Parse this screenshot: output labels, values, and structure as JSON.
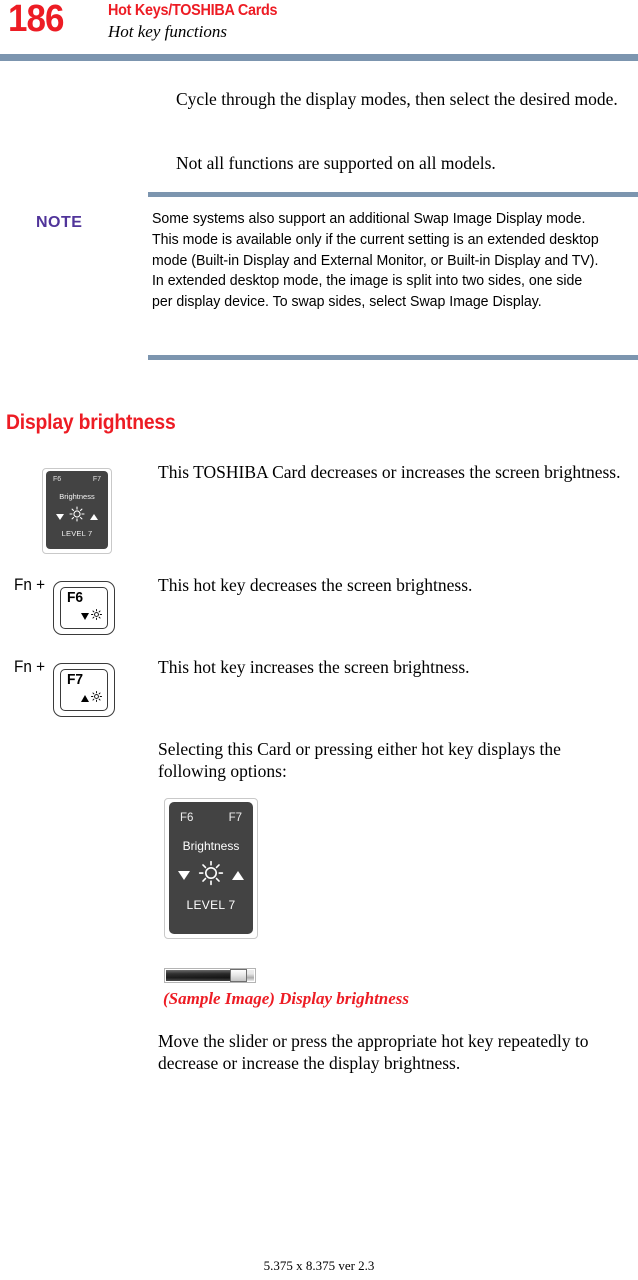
{
  "header": {
    "page_number": "186",
    "chapter_title": "Hot Keys/TOSHIBA Cards",
    "section_title": "Hot key functions",
    "rule_color": "#7c95af",
    "accent_color": "#ed1c24"
  },
  "intro": {
    "paragraph_1": "Cycle through the display modes, then select the desired mode.",
    "paragraph_2": "Not all functions are supported on all models."
  },
  "note": {
    "label": "NOTE",
    "label_color": "#50349a",
    "text": "Some systems also support an additional Swap Image Display mode. This mode is available only if the current setting is an extended desktop mode (Built-in Display and External Monitor, or Built-in Display and TV). In extended desktop mode, the image is split into two sides, one side per display device. To swap sides, select Swap Image Display."
  },
  "section": {
    "heading": "Display brightness"
  },
  "toshiba_card_small": {
    "fn_left": "F6",
    "fn_right": "F7",
    "title": "Brightness",
    "level": "LEVEL 7",
    "decrease_icon": "triangle-down-icon",
    "sun_icon": "sun-brightness-icon",
    "increase_icon": "triangle-up-icon",
    "background_color": "#434343",
    "description": "This TOSHIBA Card decreases or increases the screen brightness."
  },
  "hotkey_f6": {
    "modifier": "Fn +",
    "key_label": "F6",
    "glyph_triangle": "triangle-down-icon",
    "glyph_sun": "sun-brightness-icon",
    "description": "This hot key decreases the screen brightness."
  },
  "hotkey_f7": {
    "modifier": "Fn +",
    "key_label": "F7",
    "glyph_triangle": "triangle-up-icon",
    "glyph_sun": "sun-brightness-icon",
    "description": "This hot key increases the screen brightness."
  },
  "options_intro": "Selecting this Card or pressing either hot key displays the following options:",
  "toshiba_card_large": {
    "fn_left": "F6",
    "fn_right": "F7",
    "title": "Brightness",
    "level": "LEVEL 7",
    "decrease_icon": "triangle-down-icon",
    "sun_icon": "sun-brightness-icon",
    "increase_icon": "triangle-up-icon",
    "background_color": "#434343"
  },
  "slider": {
    "name": "brightness-slider",
    "fill_percent": 82,
    "caption": "(Sample Image) Display brightness",
    "caption_color": "#ed1c24"
  },
  "closing_paragraph": "Move the slider or press the appropriate hot key repeatedly to decrease or increase the display brightness.",
  "footer": {
    "text": "5.375 x 8.375 ver 2.3"
  }
}
